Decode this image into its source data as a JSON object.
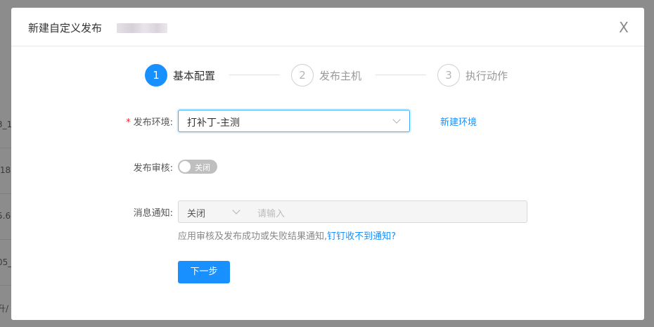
{
  "background": {
    "row_fragments": [
      "3_1",
      ".18",
      "5.6",
      "05_",
      "升/"
    ]
  },
  "modal": {
    "title": "新建自定义发布",
    "close_glyph": "X"
  },
  "steps": [
    {
      "number": "1",
      "label": "基本配置",
      "active": true
    },
    {
      "number": "2",
      "label": "发布主机",
      "active": false
    },
    {
      "number": "3",
      "label": "执行动作",
      "active": false
    }
  ],
  "form": {
    "env": {
      "required_mark": "*",
      "label": "发布环境:",
      "value": "打补丁-主测",
      "new_env_link": "新建环境"
    },
    "review": {
      "label": "发布审核:",
      "switch_text": "关闭",
      "enabled": false
    },
    "notify": {
      "label": "消息通知:",
      "select_value": "关闭",
      "input_placeholder": "请输入",
      "hint": "应用审核及发布成功或失败结果通知,",
      "hint_link": "钉钉收不到通知?"
    },
    "next_button": "下一步"
  },
  "colors": {
    "primary": "#1890ff",
    "required": "#f5222d",
    "switch_off": "#bfbfbf"
  }
}
